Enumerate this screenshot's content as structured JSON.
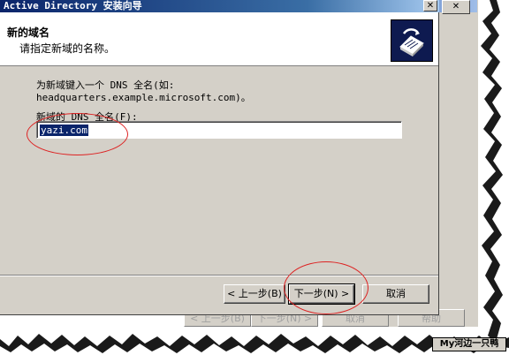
{
  "window": {
    "title": "Active Directory 安装向导",
    "close_glyph": "✕"
  },
  "header": {
    "title": "新的域名",
    "subtitle": "请指定新域的名称。"
  },
  "body": {
    "description_line1": "为新域键入一个 DNS 全名(如:",
    "description_line2": "headquarters.example.microsoft.com)。",
    "field_label": "新域的 DNS 全名(F):",
    "field_value": "yazi.com"
  },
  "buttons": {
    "back": "< 上一步(B)",
    "next": "下一步(N) >",
    "cancel": "取消"
  },
  "background_window": {
    "back": "< 上一步(B)",
    "next": "下一步(N) >",
    "cancel": "取消",
    "help": "帮助"
  },
  "watermark": "My河边一只鸭",
  "colors": {
    "title_bar": "#0a246a",
    "dialog_face": "#d4d0c8",
    "selection": "#0a246a",
    "annotation": "#dd2222"
  },
  "icons": {
    "wizard_banner": "directory-book-icon",
    "close": "close-icon"
  }
}
